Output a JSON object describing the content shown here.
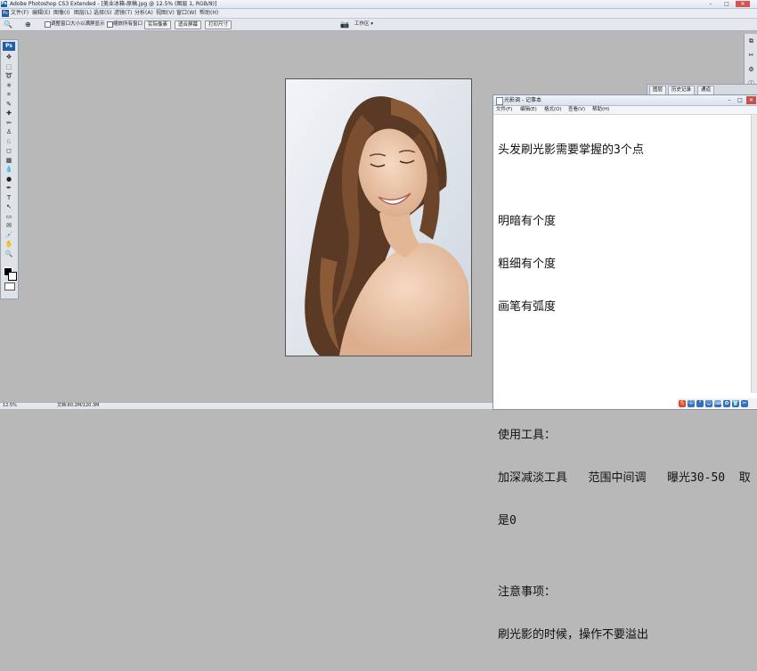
{
  "app": {
    "title": "Adobe Photoshop CS3 Extended - [美业冰箱-原稿.jpg @ 12.5% (图层 1, RGB/8)]",
    "logo": "Ps"
  },
  "window_controls": {
    "minimize": "–",
    "maximize": "□",
    "close": "✕"
  },
  "menu": [
    "文件(F)",
    "编辑(E)",
    "图像(I)",
    "图层(L)",
    "选择(S)",
    "滤镜(T)",
    "分析(A)",
    "视图(V)",
    "窗口(W)",
    "帮助(H)"
  ],
  "options": {
    "resize_windows": "调整窗口大小以满屏显示",
    "zoom_all": "缩放所有窗口",
    "actual_pixels": "实际像素",
    "fit_screen": "适合屏幕",
    "print_size": "打印尺寸",
    "workspace": "工作区 ▾"
  },
  "toolbox": {
    "logo": "Ps",
    "tools": [
      "move-tool",
      "marquee-tool",
      "lasso-tool",
      "magic-wand-tool",
      "crop-tool",
      "slice-tool",
      "healing-brush-tool",
      "brush-tool",
      "clone-stamp-tool",
      "history-brush-tool",
      "eraser-tool",
      "gradient-tool",
      "blur-tool",
      "dodge-tool",
      "pen-tool",
      "type-tool",
      "path-selection-tool",
      "shape-tool",
      "notes-tool",
      "eyedropper-tool",
      "hand-tool",
      "zoom-tool"
    ],
    "glyphs": [
      "✥",
      "⬚",
      "➰",
      "✳",
      "⌗",
      "✎",
      "✚",
      "✏",
      "♙",
      "♘",
      "◻",
      "▦",
      "💧",
      "●",
      "✒",
      "T",
      "↖",
      "▭",
      "✉",
      "💉",
      "✋",
      "🔍"
    ]
  },
  "panels": {
    "tabs": [
      "图层",
      "历史记录",
      "通道"
    ]
  },
  "notepad": {
    "title": "光影调 - 记事本",
    "menu": [
      "文件(F)",
      "编辑(E)",
      "格式(O)",
      "查看(V)",
      "帮助(H)"
    ],
    "lines": [
      "头发刷光影需要掌握的3个点",
      "",
      "明暗有个度",
      "粗细有个度",
      "画笔有弧度",
      "",
      "",
      "",
      "使用工具：",
      "加深减淡工具   范围中间调   曝光30-50  取",
      "是0",
      "",
      "注意事项：",
      "刷光影的时候，操作不要溢出"
    ]
  },
  "status": {
    "zoom": "12.5%",
    "doc": "文档:60.2M/120.3M"
  },
  "tray": {
    "ime": "S",
    "labels": [
      "中",
      "°",
      "☺",
      "⌨",
      "✿",
      "👕",
      "✂"
    ]
  }
}
